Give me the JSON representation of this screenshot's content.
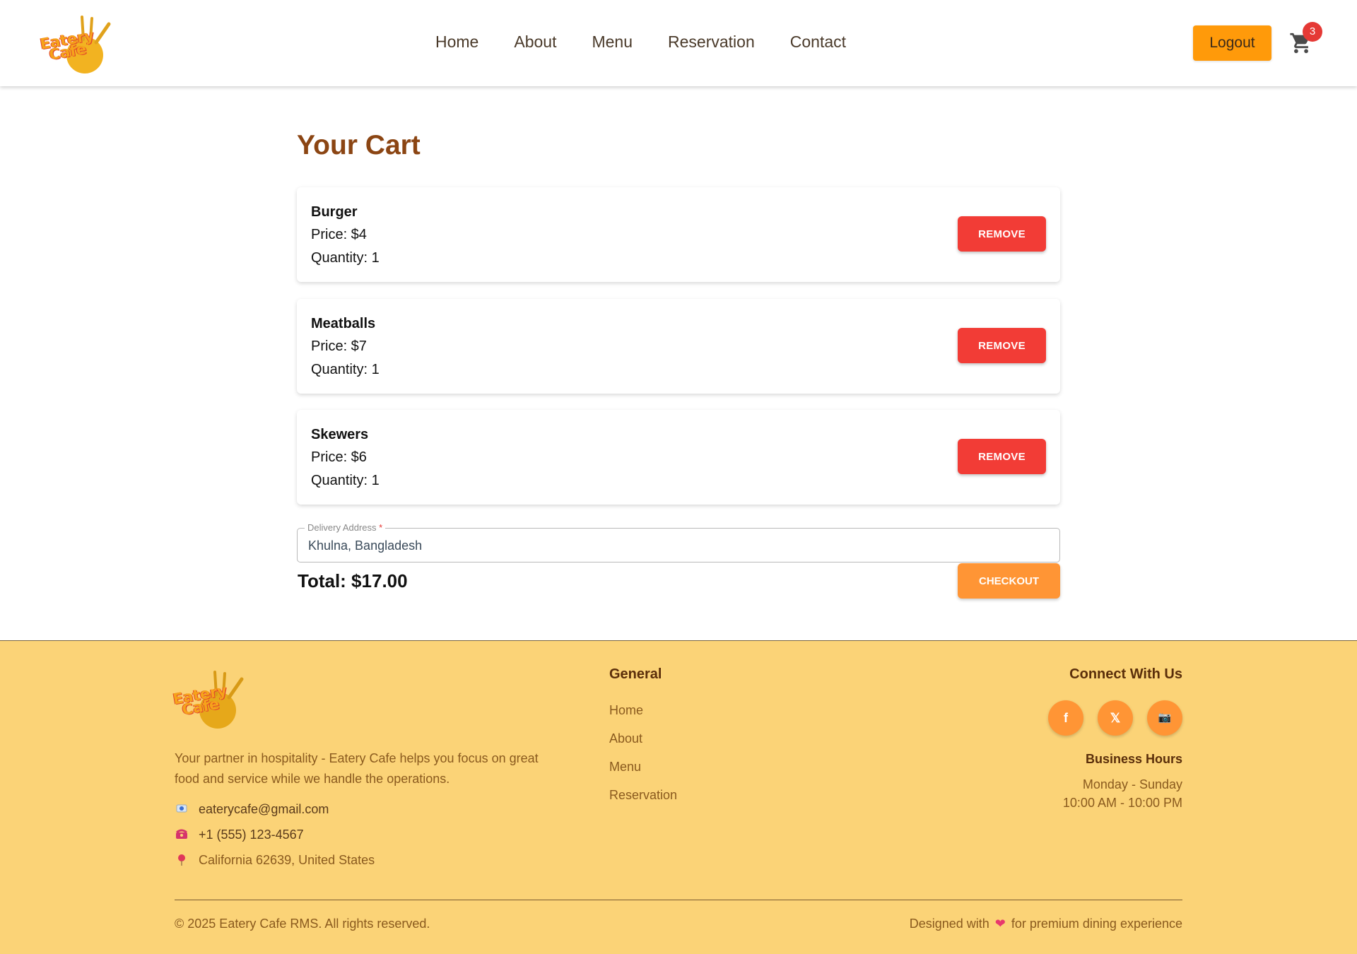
{
  "brand": {
    "logo_line1": "Eatery",
    "logo_line2": "Cafe"
  },
  "nav": {
    "items": [
      "Home",
      "About",
      "Menu",
      "Reservation",
      "Contact"
    ]
  },
  "header": {
    "logout_label": "Logout",
    "cart_count": "3",
    "cart_icon": "shopping-cart-icon"
  },
  "cart": {
    "title": "Your Cart",
    "items": [
      {
        "name": "Burger",
        "price": "Price: $4",
        "quantity": "Quantity: 1"
      },
      {
        "name": "Meatballs",
        "price": "Price: $7",
        "quantity": "Quantity: 1"
      },
      {
        "name": "Skewers",
        "price": "Price: $6",
        "quantity": "Quantity: 1"
      }
    ],
    "remove_label": "REMOVE",
    "address": {
      "label": "Delivery Address",
      "required_mark": "*",
      "value": "Khulna, Bangladesh"
    },
    "total": "Total: $17.00",
    "checkout_label": "CHECKOUT"
  },
  "footer": {
    "description": "Your partner in hospitality - Eatery Cafe helps you focus on great food and service while we handle the operations.",
    "email": "eaterycafe@gmail.com",
    "phone": "+1 (555) 123-4567",
    "address": "California 62639, United States",
    "general_heading": "General",
    "general_links": [
      "Home",
      "About",
      "Menu",
      "Reservation"
    ],
    "connect_heading": "Connect With Us",
    "social": [
      {
        "icon": "facebook-icon",
        "glyph": "f"
      },
      {
        "icon": "x-twitter-icon",
        "glyph": "𝕏"
      },
      {
        "icon": "instagram-icon",
        "glyph": "📷"
      }
    ],
    "hours_heading": "Business Hours",
    "hours_days": "Monday - Sunday",
    "hours_time": "10:00 AM - 10:00 PM",
    "copyright": "© 2025 Eatery Cafe RMS. All rights reserved.",
    "designed_prefix": "Designed with",
    "designed_suffix": "for premium dining experience"
  },
  "colors": {
    "brand_orange": "#ff9a0a",
    "title_brown": "#8b4513",
    "remove_red": "#f23c36",
    "checkout_orange": "#ff9535",
    "footer_bg": "#fbd377"
  }
}
